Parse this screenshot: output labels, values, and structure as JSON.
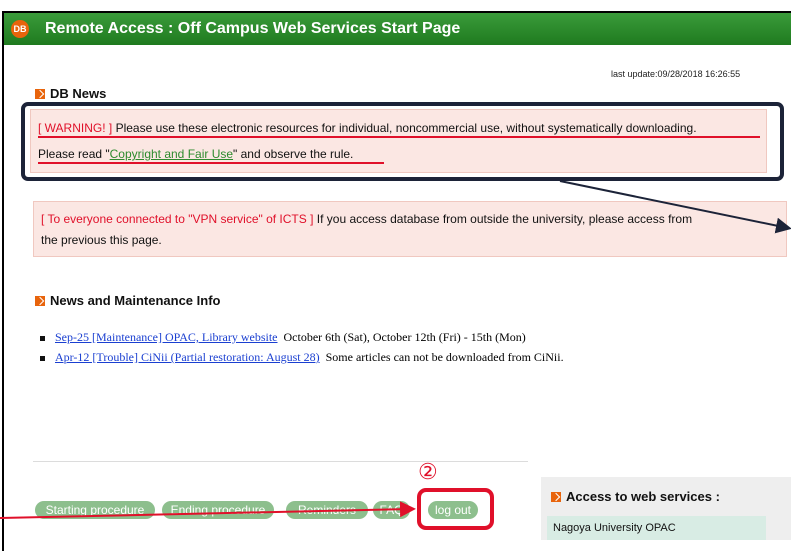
{
  "header": {
    "logo": "DB",
    "title": "Remote Access : Off Campus Web Services Start Page"
  },
  "last_update": "last update:09/28/2018 16:26:55",
  "db_news": {
    "title": "DB News",
    "warning_tag": "[ WARNING! ]",
    "warning_text": " Please use these electronic resources for individual, noncommercial use, without systematically downloading.",
    "read_prefix": "Please read \"",
    "copyright_link": "Copyright and Fair Use",
    "read_suffix": "\" and observe the rule.",
    "vpn_tag": "[ To everyone connected to \"VPN service\" of ICTS ]",
    "vpn_text": " If you access database from outside the university, please access from",
    "vpn_text2": "the previous this page."
  },
  "news": {
    "title": "News and Maintenance Info",
    "items": [
      {
        "link": "Sep-25 [Maintenance] OPAC, Library website",
        "text": "October 6th (Sat), October 12th (Fri) - 15th (Mon)"
      },
      {
        "link": "Apr-12 [Trouble] CiNii (Partial restoration: August 28)",
        "text": "Some articles can not be downloaded from CiNii."
      }
    ]
  },
  "buttons": {
    "starting": "Starting procedure",
    "ending": "Ending procedure",
    "reminders": "Reminders",
    "faq": "FAQ",
    "logout": "log out"
  },
  "annotation": "②",
  "access_panel": {
    "title": "Access to web services :",
    "item": "Nagoya University OPAC"
  },
  "colors": {
    "header_green": "#2e8b2e",
    "accent_orange": "#e8640c",
    "highlight_red": "#e0102a",
    "dark_frame": "#1c2338"
  }
}
